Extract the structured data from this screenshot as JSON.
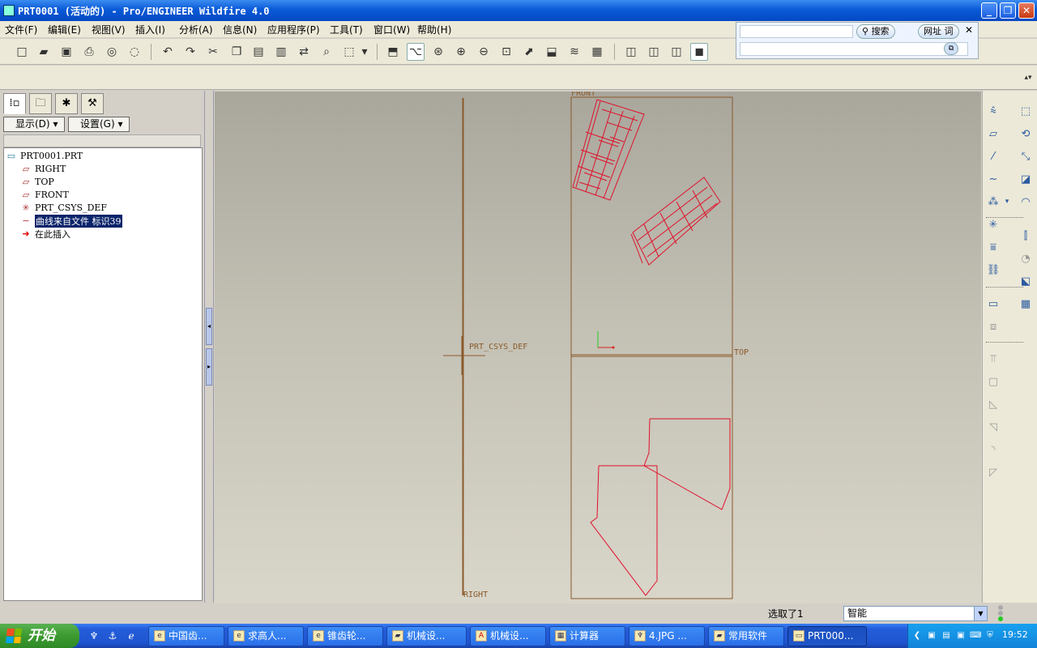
{
  "window": {
    "title": "PRT0001 (活动的) - Pro/ENGINEER Wildfire 4.0",
    "minimize": "_",
    "restore": "❐",
    "close": "✕"
  },
  "menu": [
    {
      "label": "文件(F)"
    },
    {
      "label": "编辑(E)"
    },
    {
      "label": "视图(V)"
    },
    {
      "label": "插入(I)"
    },
    {
      "label": "分析(A)"
    },
    {
      "label": "信息(N)"
    },
    {
      "label": "应用程序(P)"
    },
    {
      "label": "工具(T)"
    },
    {
      "label": "窗口(W)"
    },
    {
      "label": "帮助(H)"
    }
  ],
  "toolbar": {
    "icons": [
      "new-icon",
      "open-icon",
      "save-icon",
      "print-icon",
      "preview-icon",
      "email-icon",
      "undo-icon",
      "redo-icon",
      "cut-icon",
      "copy-icon",
      "paste-icon",
      "paste-special-icon",
      "regenerate-icon",
      "find-icon",
      "select-box-icon",
      "repaint-icon",
      "spin-center-icon",
      "orient-icon",
      "zoom-in-icon",
      "zoom-out-icon",
      "refit-icon",
      "reorient-icon",
      "saved-views-icon",
      "layers-icon",
      "view-manager-icon",
      "wireframe-icon",
      "hidden-line-icon",
      "no-hidden-icon",
      "shading-icon"
    ]
  },
  "search_widget": {
    "search_label": "搜索",
    "url_label": "网址",
    "word_label": "词",
    "close": "✕"
  },
  "left_panel": {
    "display_button": "显示(D)",
    "settings_button": "设置(G)",
    "tree": [
      {
        "label": "PRT0001.PRT",
        "icon": "part-icon",
        "selected": false
      },
      {
        "label": "RIGHT",
        "icon": "datum-plane-icon",
        "selected": false
      },
      {
        "label": "TOP",
        "icon": "datum-plane-icon",
        "selected": false
      },
      {
        "label": "FRONT",
        "icon": "datum-plane-icon",
        "selected": false
      },
      {
        "label": "PRT_CSYS_DEF",
        "icon": "csys-icon",
        "selected": false
      },
      {
        "label": "曲线来自文件 标识39",
        "icon": "curve-icon",
        "selected": true
      },
      {
        "label": "在此插入",
        "icon": "insert-here-arrow-icon",
        "selected": false
      }
    ]
  },
  "graphics": {
    "labels": {
      "front": "FRONT",
      "top": "TOP",
      "right": "RIGHT",
      "csys": "PRT_CSYS_DEF"
    },
    "datum_color": "#8a5a2a",
    "curve_color": "#e0102a"
  },
  "status": {
    "message": "选取了1",
    "filter_value": "智能"
  },
  "taskbar": {
    "start_label": "开始",
    "tasks": [
      {
        "label": "中国齿..."
      },
      {
        "label": "求高人..."
      },
      {
        "label": "锥齿轮..."
      },
      {
        "label": "机械设..."
      },
      {
        "label": "机械设..."
      },
      {
        "label": "计算器"
      },
      {
        "label": "4.JPG ..."
      },
      {
        "label": "常用软件"
      },
      {
        "label": "PRT000..."
      }
    ],
    "clock": "19:52"
  }
}
